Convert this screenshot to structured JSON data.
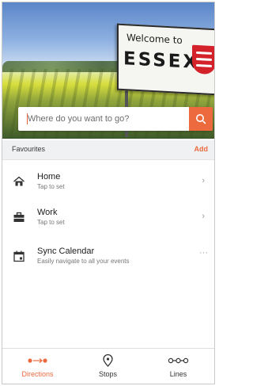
{
  "hero": {
    "sign_line1": "Welcome to",
    "sign_line2": "ESSEX"
  },
  "search": {
    "placeholder": "Where do you want to go?",
    "icon": "search-icon"
  },
  "favourites": {
    "header": "Favourites",
    "add_label": "Add",
    "items": [
      {
        "title": "Home",
        "subtitle": "Tap to set",
        "icon": "home-icon",
        "trailing": "›"
      },
      {
        "title": "Work",
        "subtitle": "Tap to set",
        "icon": "briefcase-icon",
        "trailing": "›"
      },
      {
        "title": "Sync Calendar",
        "subtitle": "Easily navigate to all your events",
        "icon": "calendar-icon",
        "trailing": "···"
      }
    ]
  },
  "tabs": [
    {
      "label": "Directions",
      "icon": "directions-icon",
      "active": true
    },
    {
      "label": "Stops",
      "icon": "stop-pin-icon",
      "active": false
    },
    {
      "label": "Lines",
      "icon": "lines-icon",
      "active": false
    }
  ],
  "colors": {
    "accent": "#ec6a3d",
    "header_bg": "#f0f1f3"
  }
}
